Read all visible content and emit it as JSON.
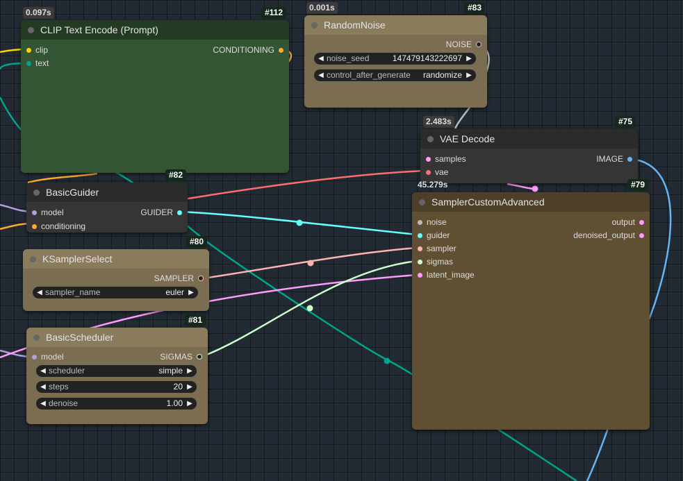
{
  "nodes": {
    "clip": {
      "id": "#112",
      "timer": "0.097s",
      "title": "CLIP Text Encode (Prompt)",
      "inputs": [
        "clip",
        "text"
      ],
      "output": "CONDITIONING"
    },
    "noise": {
      "id": "#83",
      "timer": "0.001s",
      "title": "RandomNoise",
      "output": "NOISE",
      "widgets": [
        {
          "name": "noise_seed",
          "value": "147479143222697"
        },
        {
          "name": "control_after_generate",
          "value": "randomize"
        }
      ]
    },
    "vae": {
      "id": "#75",
      "timer": "2.483s",
      "title": "VAE Decode",
      "inputs": [
        "samples",
        "vae"
      ],
      "output": "IMAGE"
    },
    "guider": {
      "id": "#82",
      "title": "BasicGuider",
      "inputs": [
        "model",
        "conditioning"
      ],
      "output": "GUIDER"
    },
    "sampler_custom": {
      "id": "#79",
      "timer": "45.279s",
      "title": "SamplerCustomAdvanced",
      "inputs": [
        "noise",
        "guider",
        "sampler",
        "sigmas",
        "latent_image"
      ],
      "outputs": [
        "output",
        "denoised_output"
      ]
    },
    "ksampler": {
      "id": "#80",
      "title": "KSamplerSelect",
      "output": "SAMPLER",
      "widgets": [
        {
          "name": "sampler_name",
          "value": "euler"
        }
      ]
    },
    "scheduler": {
      "id": "#81",
      "title": "BasicScheduler",
      "inputs": [
        "model"
      ],
      "output": "SIGMAS",
      "widgets": [
        {
          "name": "scheduler",
          "value": "simple"
        },
        {
          "name": "steps",
          "value": "20"
        },
        {
          "name": "denoise",
          "value": "1.00"
        }
      ]
    }
  },
  "colors": {
    "clip": "#ffd500",
    "conditioning": "#ffa931",
    "model": "#b39ddb",
    "guider": "#66ffff",
    "sampler": "#ffb3b3",
    "sigmas": "#ccffcc",
    "latent": "#ff9cf9",
    "vae": "#ff6e6e",
    "image": "#64b5f6",
    "noise": "#bbbbbb",
    "text": "#00a58a"
  }
}
